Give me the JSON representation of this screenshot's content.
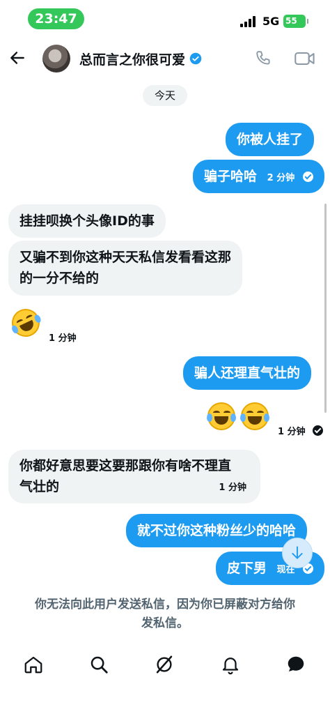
{
  "status_bar": {
    "time": "23:47",
    "network": "5G",
    "battery": "55"
  },
  "header": {
    "contact_name": "总而言之你很可爱"
  },
  "chat": {
    "day_label": "今天",
    "messages": [
      {
        "text": "你被人挂了"
      },
      {
        "text": "骗子哈哈",
        "meta": "2 分钟"
      },
      {
        "text": "挂挂呗换个头像ID的事"
      },
      {
        "line1": "又骗不到你这种天天私信发看看这那",
        "line2": "的一分不给的"
      },
      {
        "meta": "1 分钟"
      },
      {
        "text": "骗人还理直气壮的"
      },
      {
        "meta": "1 分钟"
      },
      {
        "line1": "你都好意思要这要那跟你有啥不理直",
        "line2": "气壮的",
        "meta": "1 分钟"
      },
      {
        "text": "就不过你这种粉丝少的哈哈"
      },
      {
        "text": "皮下男",
        "meta": "现在"
      }
    ],
    "blocked_notice_line1": "你无法向此用户发送私信，因为你已屏蔽对方给你",
    "blocked_notice_line2": "发私信。"
  },
  "tabs": [
    "home-icon",
    "search-icon",
    "grok-icon",
    "notifications-icon",
    "messages-icon"
  ],
  "colors": {
    "accent": "#1d9bf0",
    "incoming_bubble": "#eff3f4",
    "status_pill": "#34c759"
  }
}
